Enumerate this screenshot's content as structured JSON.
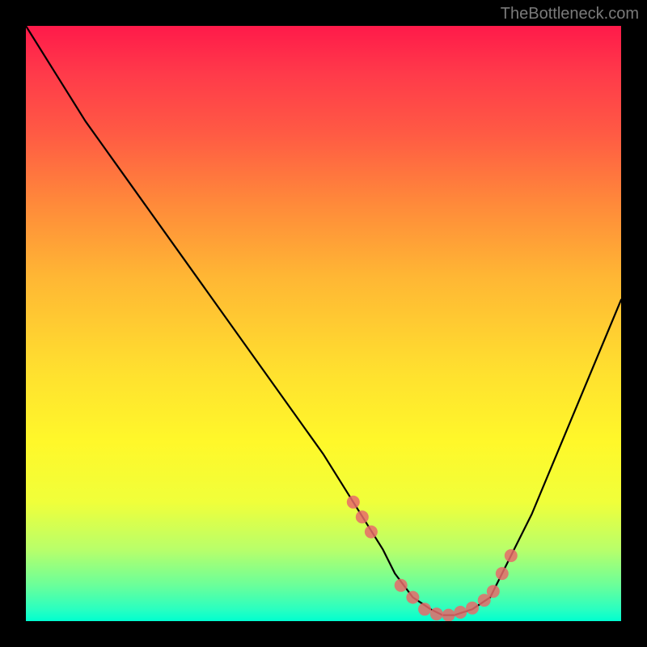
{
  "watermark": "TheBottleneck.com",
  "chart_data": {
    "type": "line",
    "title": "",
    "xlabel": "",
    "ylabel": "",
    "xlim": [
      0,
      100
    ],
    "ylim": [
      0,
      100
    ],
    "series": [
      {
        "name": "bottleneck-curve",
        "x": [
          0,
          5,
          10,
          15,
          20,
          25,
          30,
          35,
          40,
          45,
          50,
          55,
          60,
          62,
          65,
          68,
          70,
          72,
          75,
          78,
          80,
          85,
          90,
          95,
          100
        ],
        "y": [
          100,
          92,
          84,
          77,
          70,
          63,
          56,
          49,
          42,
          35,
          28,
          20,
          12,
          8,
          4,
          2,
          1,
          1,
          2,
          4,
          8,
          18,
          30,
          42,
          54
        ]
      }
    ],
    "markers": {
      "name": "highlight-points",
      "x": [
        55,
        56.5,
        58,
        63,
        65,
        67,
        69,
        71,
        73,
        75,
        77,
        78.5,
        80,
        81.5
      ],
      "y": [
        20,
        17.5,
        15,
        6,
        4,
        2,
        1.2,
        1,
        1.5,
        2.2,
        3.5,
        5,
        8,
        11
      ]
    },
    "gradient_stops": [
      {
        "pos": 0.0,
        "color": "#ff1a4a"
      },
      {
        "pos": 0.18,
        "color": "#ff5a44"
      },
      {
        "pos": 0.42,
        "color": "#ffb634"
      },
      {
        "pos": 0.7,
        "color": "#fff82a"
      },
      {
        "pos": 0.88,
        "color": "#b8ff6a"
      },
      {
        "pos": 1.0,
        "color": "#00ffd0"
      }
    ]
  }
}
